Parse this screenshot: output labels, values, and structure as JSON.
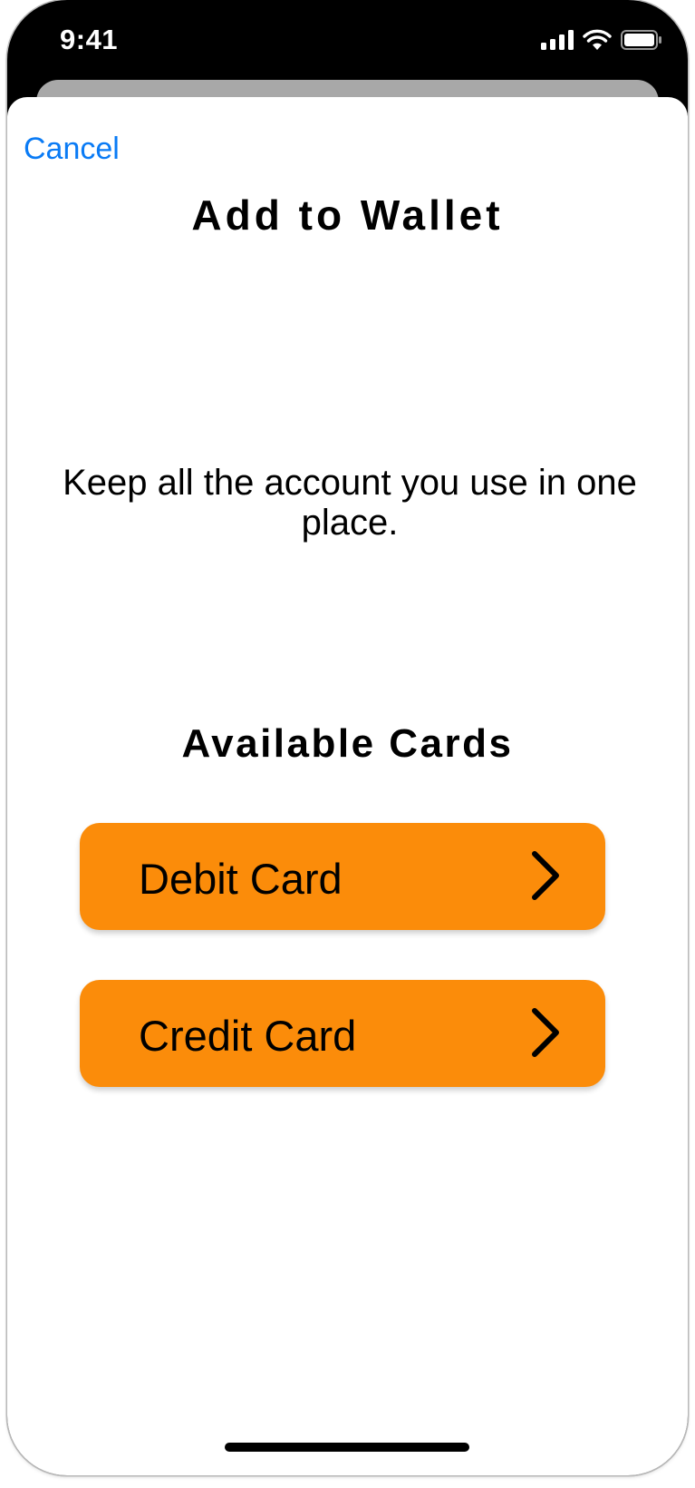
{
  "status_bar": {
    "time": "9:41",
    "icons": [
      "cellular-signal-icon",
      "wifi-icon",
      "battery-icon"
    ]
  },
  "sheet": {
    "cancel_label": "Cancel",
    "title": "Add to Wallet",
    "tagline": "Keep all the account you use in one place.",
    "section_title": "Available Cards",
    "cards": [
      {
        "label": "Debit Card",
        "icon": "chevron-right-icon"
      },
      {
        "label": "Credit Card",
        "icon": "chevron-right-icon"
      }
    ]
  },
  "colors": {
    "accent": "#0a7bf5",
    "button": "#fb8c0a",
    "text": "#000000",
    "background": "#ffffff"
  }
}
